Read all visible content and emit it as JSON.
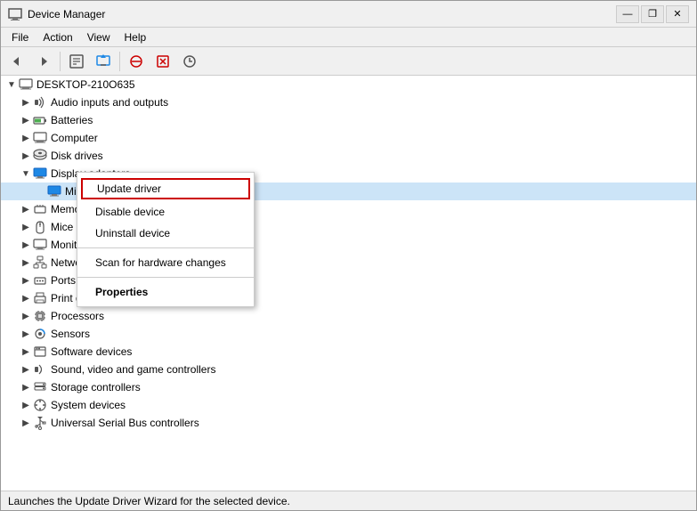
{
  "window": {
    "title": "Device Manager",
    "controls": {
      "minimize": "—",
      "restore": "❐",
      "close": "✕"
    }
  },
  "menu": {
    "items": [
      "File",
      "Action",
      "View",
      "Help"
    ]
  },
  "toolbar": {
    "buttons": [
      "◀",
      "▶",
      "⊞",
      "⊟",
      "🖥",
      "❓",
      "⊠",
      "⊙"
    ]
  },
  "tree": {
    "root": {
      "label": "DESKTOP-210O635",
      "expanded": true
    },
    "items": [
      {
        "id": "audio",
        "label": "Audio inputs and outputs",
        "indent": 2,
        "expanded": false,
        "icon": "audio"
      },
      {
        "id": "batteries",
        "label": "Batteries",
        "indent": 2,
        "expanded": false,
        "icon": "battery"
      },
      {
        "id": "computer",
        "label": "Computer",
        "indent": 2,
        "expanded": false,
        "icon": "computer"
      },
      {
        "id": "disk",
        "label": "Disk drives",
        "indent": 2,
        "expanded": false,
        "icon": "disk"
      },
      {
        "id": "display",
        "label": "Display adapters",
        "indent": 2,
        "expanded": true,
        "icon": "display"
      },
      {
        "id": "display-sub",
        "label": "Microsoft Basic Display Adapter",
        "indent": 3,
        "expanded": false,
        "icon": "display-sub",
        "selected": true
      },
      {
        "id": "memory",
        "label": "Memory devices",
        "indent": 2,
        "expanded": false,
        "icon": "memory"
      },
      {
        "id": "mice",
        "label": "Mice and other pointing devices",
        "indent": 2,
        "expanded": false,
        "icon": "mouse"
      },
      {
        "id": "monitors",
        "label": "Monitors",
        "indent": 2,
        "expanded": false,
        "icon": "monitor"
      },
      {
        "id": "network",
        "label": "Network adapters",
        "indent": 2,
        "expanded": false,
        "icon": "network"
      },
      {
        "id": "ports",
        "label": "Ports (COM & LPT)",
        "indent": 2,
        "expanded": false,
        "icon": "ports"
      },
      {
        "id": "print",
        "label": "Print queues",
        "indent": 2,
        "expanded": false,
        "icon": "print"
      },
      {
        "id": "processors",
        "label": "Processors",
        "indent": 2,
        "expanded": false,
        "icon": "processor"
      },
      {
        "id": "sensors",
        "label": "Sensors",
        "indent": 2,
        "expanded": false,
        "icon": "sensor"
      },
      {
        "id": "software",
        "label": "Software devices",
        "indent": 2,
        "expanded": false,
        "icon": "software"
      },
      {
        "id": "sound",
        "label": "Sound, video and game controllers",
        "indent": 2,
        "expanded": false,
        "icon": "sound"
      },
      {
        "id": "storage",
        "label": "Storage controllers",
        "indent": 2,
        "expanded": false,
        "icon": "storage"
      },
      {
        "id": "system",
        "label": "System devices",
        "indent": 2,
        "expanded": false,
        "icon": "system"
      },
      {
        "id": "usb",
        "label": "Universal Serial Bus controllers",
        "indent": 2,
        "expanded": false,
        "icon": "usb"
      }
    ]
  },
  "context_menu": {
    "items": [
      {
        "id": "update-driver",
        "label": "Update driver",
        "highlighted": true
      },
      {
        "id": "disable-device",
        "label": "Disable device"
      },
      {
        "id": "uninstall-device",
        "label": "Uninstall device"
      },
      {
        "id": "scan",
        "label": "Scan for hardware changes"
      },
      {
        "id": "properties",
        "label": "Properties",
        "bold": true
      }
    ]
  },
  "status_bar": {
    "text": "Launches the Update Driver Wizard for the selected device."
  }
}
